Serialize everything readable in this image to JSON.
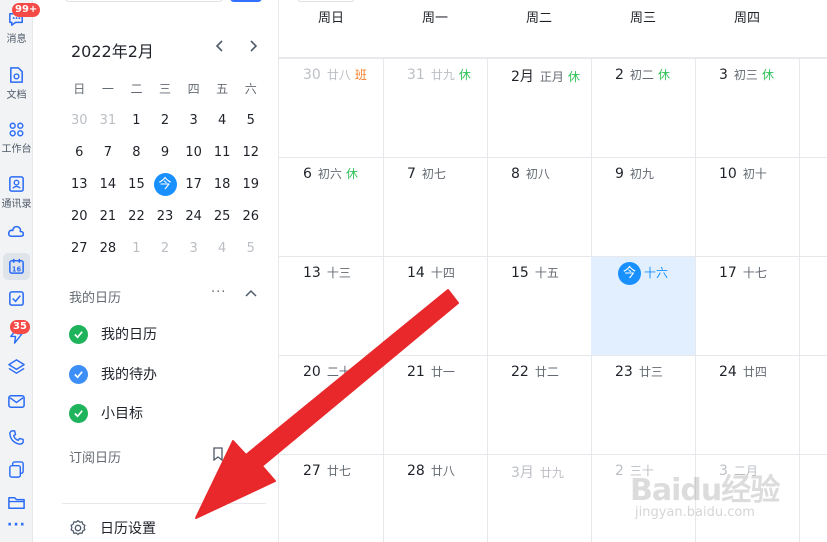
{
  "rail": {
    "items": [
      {
        "name": "messages",
        "label": "消息",
        "badge": "99+"
      },
      {
        "name": "docs",
        "label": "文档"
      },
      {
        "name": "workbench",
        "label": "工作台"
      },
      {
        "name": "contacts",
        "label": "通讯录"
      },
      {
        "name": "cloud",
        "label": ""
      },
      {
        "name": "calendar",
        "label": "",
        "icon_text": "16"
      },
      {
        "name": "tasks",
        "label": ""
      },
      {
        "name": "flash",
        "label": "",
        "badge": "35"
      },
      {
        "name": "layers",
        "label": ""
      },
      {
        "name": "mail",
        "label": ""
      },
      {
        "name": "phone",
        "label": ""
      },
      {
        "name": "copy",
        "label": ""
      },
      {
        "name": "folder",
        "label": ""
      }
    ],
    "more": "···"
  },
  "mini_calendar": {
    "title": "2022年2月",
    "prev": "‹",
    "next": "›",
    "weekdays": [
      "日",
      "一",
      "二",
      "三",
      "四",
      "五",
      "六"
    ],
    "weeks": [
      [
        "30",
        "31",
        "1",
        "2",
        "3",
        "4",
        "5"
      ],
      [
        "6",
        "7",
        "8",
        "9",
        "10",
        "11",
        "12"
      ],
      [
        "13",
        "14",
        "15",
        "今",
        "17",
        "18",
        "19"
      ],
      [
        "20",
        "21",
        "22",
        "23",
        "24",
        "25",
        "26"
      ],
      [
        "27",
        "28",
        "1",
        "2",
        "3",
        "4",
        "5"
      ]
    ]
  },
  "my_calendars": {
    "title": "我的日历",
    "more": "···",
    "items": [
      {
        "label": "我的日历",
        "color": "#1fb35b"
      },
      {
        "label": "我的待办",
        "color": "#3d8ef7"
      },
      {
        "label": "小目标",
        "color": "#1fb35b"
      }
    ]
  },
  "subscribed": {
    "title": "订阅日历"
  },
  "settings": {
    "label": "日历设置"
  },
  "month_view": {
    "weekdays": [
      "周日",
      "周一",
      "周二",
      "周三",
      "周四"
    ],
    "weeks": [
      [
        {
          "day": "30",
          "lunar": "廿八",
          "tag": "班",
          "tag_type": "work",
          "out": true
        },
        {
          "day": "31",
          "lunar": "廿九",
          "tag": "休",
          "tag_type": "rest",
          "out": true
        },
        {
          "day": "2月",
          "lunar": "正月",
          "tag": "休",
          "tag_type": "rest"
        },
        {
          "day": "2",
          "lunar": "初二",
          "tag": "休",
          "tag_type": "rest"
        },
        {
          "day": "3",
          "lunar": "初三",
          "tag": "休",
          "tag_type": "rest"
        }
      ],
      [
        {
          "day": "6",
          "lunar": "初六",
          "tag": "休",
          "tag_type": "rest"
        },
        {
          "day": "7",
          "lunar": "初七"
        },
        {
          "day": "8",
          "lunar": "初八"
        },
        {
          "day": "9",
          "lunar": "初九"
        },
        {
          "day": "10",
          "lunar": "初十"
        }
      ],
      [
        {
          "day": "13",
          "lunar": "十三"
        },
        {
          "day": "14",
          "lunar": "十四"
        },
        {
          "day": "15",
          "lunar": "十五"
        },
        {
          "day": "今",
          "lunar": "十六",
          "today": true
        },
        {
          "day": "17",
          "lunar": "十七"
        }
      ],
      [
        {
          "day": "20",
          "lunar": "二十"
        },
        {
          "day": "21",
          "lunar": "廿一"
        },
        {
          "day": "22",
          "lunar": "廿二"
        },
        {
          "day": "23",
          "lunar": "廿三"
        },
        {
          "day": "24",
          "lunar": "廿四"
        }
      ],
      [
        {
          "day": "27",
          "lunar": "廿七"
        },
        {
          "day": "28",
          "lunar": "廿八"
        },
        {
          "day": "3月",
          "lunar": "廿九",
          "out": true
        },
        {
          "day": "2",
          "lunar": "三十",
          "out": true
        },
        {
          "day": "3",
          "lunar": "二月",
          "out": true
        }
      ]
    ]
  },
  "watermark": {
    "logo": "Baidu经验",
    "sub": "jingyan.baidu.com"
  },
  "colors": {
    "accent": "#1890ff",
    "arrow": "#e8282b",
    "selected_bg": "#e1efff"
  }
}
